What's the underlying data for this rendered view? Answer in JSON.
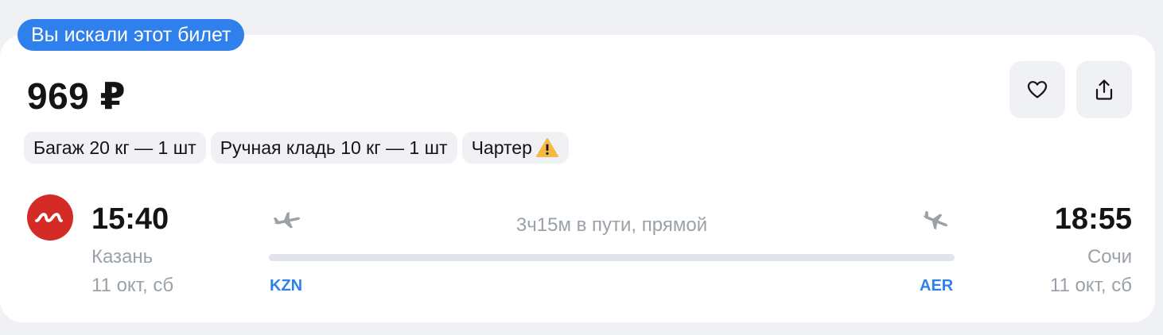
{
  "badge": {
    "label": "Вы искали этот билет"
  },
  "ticket": {
    "price": "969 ₽",
    "tags": [
      {
        "label": "Багаж 20 кг — 1 шт"
      },
      {
        "label": "Ручная кладь 10 кг — 1 шт"
      },
      {
        "label": "Чартер",
        "icon": "warning-icon"
      }
    ],
    "actions": {
      "favorite_icon": "heart-icon",
      "share_icon": "share-icon"
    },
    "airline_logo_icon": "nordwind-logo",
    "departure": {
      "time": "15:40",
      "city": "Казань",
      "date": "11 окт, сб",
      "code": "KZN"
    },
    "arrival": {
      "time": "18:55",
      "city": "Сочи",
      "date": "11 окт, сб",
      "code": "AER"
    },
    "duration_text": "3ч15м в пути, прямой"
  },
  "colors": {
    "accent": "#2f80ed",
    "airline_red": "#d52b27",
    "warning": "#f5b942",
    "muted_text": "#9aa1a8",
    "background": "#eff1f4"
  }
}
